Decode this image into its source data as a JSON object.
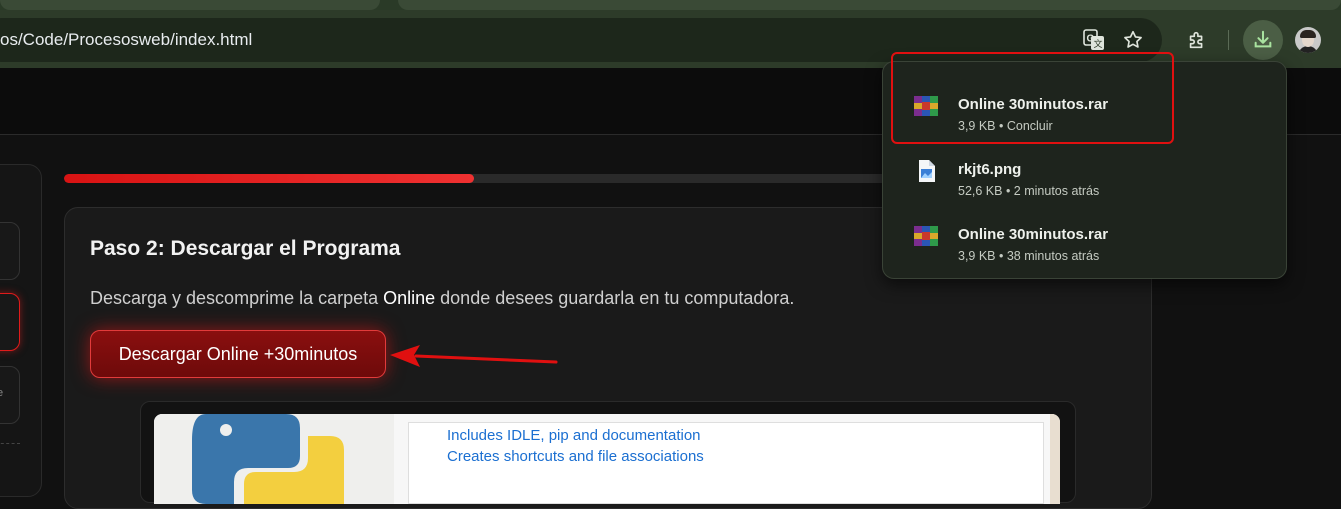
{
  "browser": {
    "url": "os/Code/Procesosweb/index.html"
  },
  "progress": {
    "percent": 38
  },
  "step": {
    "title": "Paso 2: Descargar el Programa",
    "description_before": "Descarga y descomprime la carpeta ",
    "description_bold": "Online",
    "description_after": " donde desees guardarla en tu computadora.",
    "button_label": "Descargar Online +30minutos"
  },
  "sidebar": {
    "partial_letter": "e"
  },
  "installer_preview": {
    "lines": [
      "Includes IDLE, pip and documentation",
      "Creates shortcuts and file associations"
    ]
  },
  "downloads": {
    "items": [
      {
        "name": "Online 30minutos.rar",
        "meta": "3,9 KB • Concluir",
        "icon": "winrar-archive-icon"
      },
      {
        "name": "rkjt6.png",
        "meta": "52,6 KB • 2 minutos atrás",
        "icon": "image-file-icon"
      },
      {
        "name": "Online 30minutos.rar",
        "meta": "3,9 KB • 38 minutos atrás",
        "icon": "winrar-archive-icon"
      }
    ]
  },
  "colors": {
    "accent_red": "#e01b1b",
    "toolbar_green": "#2d3b29",
    "link_blue": "#1b6fd1"
  }
}
